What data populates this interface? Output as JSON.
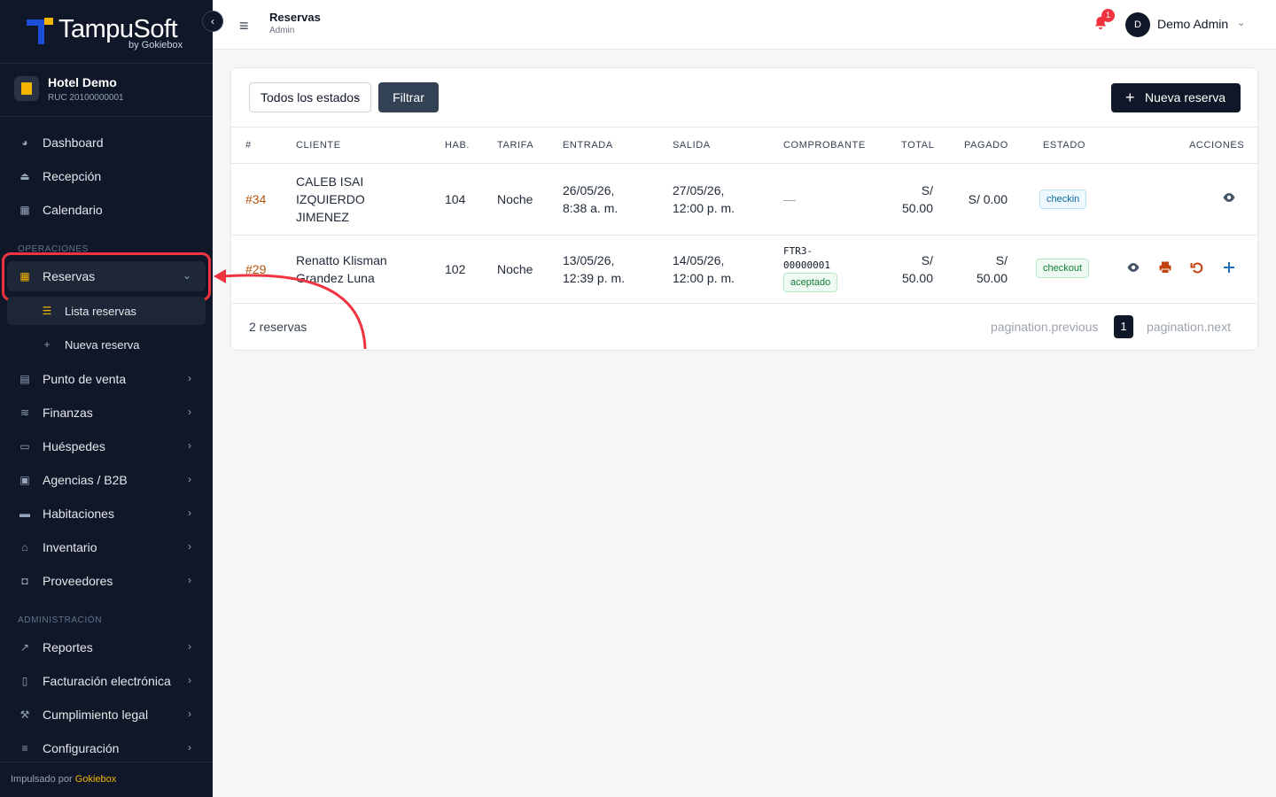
{
  "brand": {
    "name": "TampuSoft",
    "sub": "by Gokiebox"
  },
  "hotel": {
    "name": "Hotel Demo",
    "ruc": "RUC 20100000001"
  },
  "nav": {
    "dashboard": "Dashboard",
    "recepcion": "Recepción",
    "calendario": "Calendario",
    "section_operaciones": "OPERACIONES",
    "reservas": "Reservas",
    "lista_reservas": "Lista reservas",
    "nueva_reserva": "Nueva reserva",
    "punto_venta": "Punto de venta",
    "finanzas": "Finanzas",
    "huespedes": "Huéspedes",
    "agencias": "Agencias / B2B",
    "habitaciones": "Habitaciones",
    "inventario": "Inventario",
    "proveedores": "Proveedores",
    "section_administracion": "ADMINISTRACIÓN",
    "reportes": "Reportes",
    "facturacion": "Facturación electrónica",
    "cumplimiento": "Cumplimiento legal",
    "configuracion": "Configuración"
  },
  "footer": {
    "text": "Impulsado por",
    "brand": "Gokiebox"
  },
  "topbar": {
    "title": "Reservas",
    "subtitle": "Admin",
    "notifications": "1",
    "avatar_initial": "D",
    "user": "Demo Admin"
  },
  "filters": {
    "status_select": "Todos los estados",
    "filter_button": "Filtrar",
    "new_button": "Nueva reserva"
  },
  "table": {
    "headers": [
      "#",
      "CLIENTE",
      "HAB.",
      "TARIFA",
      "ENTRADA",
      "SALIDA",
      "COMPROBANTE",
      "TOTAL",
      "PAGADO",
      "ESTADO",
      "ACCIONES"
    ],
    "rows": [
      {
        "id": "#34",
        "cliente": [
          "CALEB ISAI",
          "IZQUIERDO",
          "JIMENEZ"
        ],
        "hab": "104",
        "tarifa": "Noche",
        "entrada": [
          "26/05/26,",
          "8:38 a. m."
        ],
        "salida": [
          "27/05/26,",
          "12:00 p. m."
        ],
        "comprobante": "—",
        "total": [
          "S/",
          "50.00"
        ],
        "pagado": "S/ 0.00",
        "estado": "checkin"
      },
      {
        "id": "#29",
        "cliente": [
          "Renatto Klisman",
          "Grandez Luna"
        ],
        "hab": "102",
        "tarifa": "Noche",
        "entrada": [
          "13/05/26,",
          "12:39 p. m."
        ],
        "salida": [
          "14/05/26,",
          "12:00 p. m."
        ],
        "comprobante": [
          "FTR3-",
          "00000001"
        ],
        "comprobante_status": "aceptado",
        "total": [
          "S/",
          "50.00"
        ],
        "pagado": [
          "S/",
          "50.00"
        ],
        "estado": "checkout"
      }
    ]
  },
  "pagination": {
    "count": "2 reservas",
    "previous": "pagination.previous",
    "current": "1",
    "next": "pagination.next"
  },
  "colors": {
    "sidebar": "#0f1729",
    "accent": "#f5b400",
    "highlight": "#ef3340",
    "id_link": "#b45309"
  }
}
